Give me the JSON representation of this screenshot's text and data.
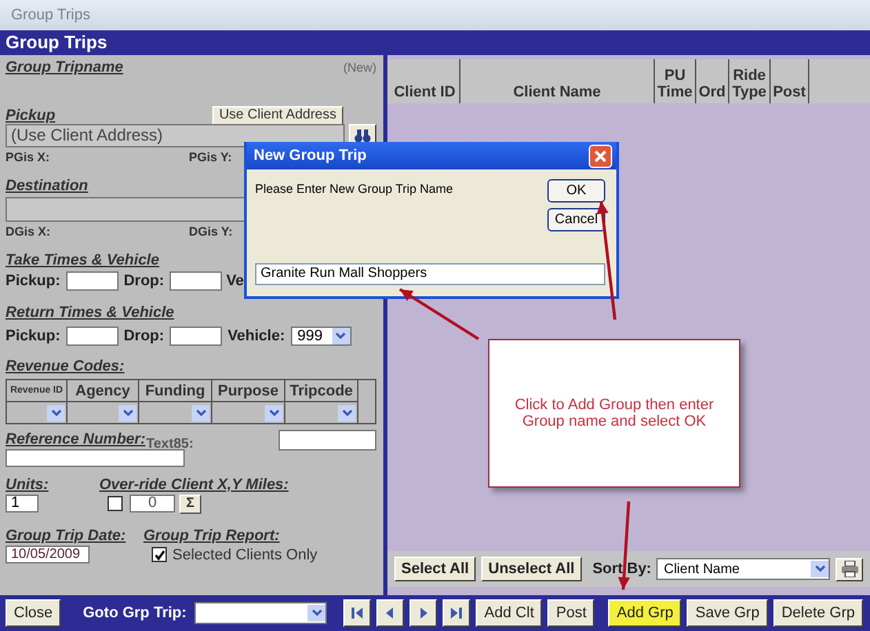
{
  "window": {
    "title": "Group Trips"
  },
  "header": {
    "title": "Group Trips"
  },
  "form": {
    "tripname": {
      "label": "Group Tripname",
      "status": "(New)"
    },
    "pickup": {
      "label": "Pickup",
      "button": "Use Client Address",
      "value": "(Use Client Address)",
      "gis_x": "PGis X:",
      "gis_y": "PGis Y:"
    },
    "destination": {
      "label": "Destination",
      "gis_x": "DGis X:",
      "gis_y": "DGis Y:"
    },
    "take": {
      "label": "Take Times & Vehicle",
      "pickup": "Pickup:",
      "drop": "Drop:",
      "vehicle": "Ve"
    },
    "return": {
      "label": "Return Times & Vehicle",
      "pickup": "Pickup:",
      "drop": "Drop:",
      "vehicle": "Vehicle:",
      "vehicle_value": "999"
    },
    "revenue": {
      "label": "Revenue Codes:",
      "columns": [
        "Revenue ID",
        "Agency",
        "Funding",
        "Purpose",
        "Tripcode"
      ]
    },
    "reference": {
      "label": "Reference Number:",
      "text85": "Text85:"
    },
    "units": {
      "label": "Units:",
      "value": "1"
    },
    "override": {
      "label": "Over-ride Client X,Y Miles:",
      "checked": false,
      "value": "0",
      "sigma": "Σ"
    },
    "date": {
      "label": "Group Trip Date:",
      "value": "10/05/2009"
    },
    "report": {
      "label": "Group Trip Report:",
      "option": "Selected Clients Only",
      "checked": true
    }
  },
  "clients": {
    "columns": [
      "Client ID",
      "Client Name",
      "PU Time",
      "Ord",
      "Ride Type",
      "Post"
    ],
    "select_all": "Select All",
    "unselect_all": "Unselect All",
    "sort_label": "Sort By:",
    "sort_value": "Client Name"
  },
  "bottom": {
    "close": "Close",
    "goto_label": "Goto Grp Trip:",
    "buttons": [
      {
        "label": "Add Clt",
        "highlighted": false
      },
      {
        "label": "Post",
        "highlighted": false
      },
      {
        "label": "Add Grp",
        "highlighted": true
      },
      {
        "label": "Save Grp",
        "highlighted": false
      },
      {
        "label": "Delete Grp",
        "highlighted": false
      }
    ]
  },
  "dialog": {
    "title": "New Group Trip",
    "prompt": "Please Enter New Group Trip Name",
    "ok": "OK",
    "cancel": "Cancel",
    "value": "Granite Run Mall Shoppers"
  },
  "callout": {
    "text": "Click to Add Group then enter Group name and select OK"
  }
}
